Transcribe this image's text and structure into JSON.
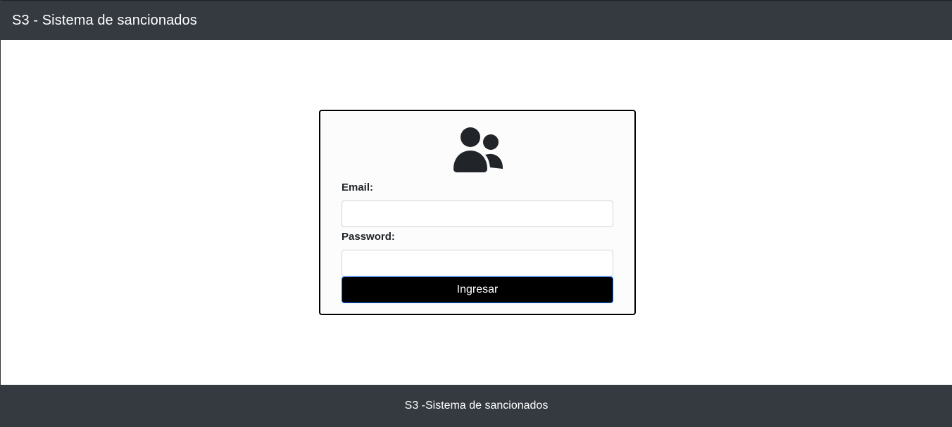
{
  "navbar": {
    "brand": "S3 - Sistema de sancionados"
  },
  "login": {
    "icon": "users-icon",
    "email_label": "Email:",
    "email_value": "",
    "password_label": "Password:",
    "password_value": "",
    "submit_label": "Ingresar"
  },
  "footer": {
    "text": "S3 -Sistema de sancionados"
  },
  "colors": {
    "header_bg": "#343a40",
    "button_bg": "#000000",
    "button_border": "#0d6efd",
    "card_border": "#000000"
  }
}
